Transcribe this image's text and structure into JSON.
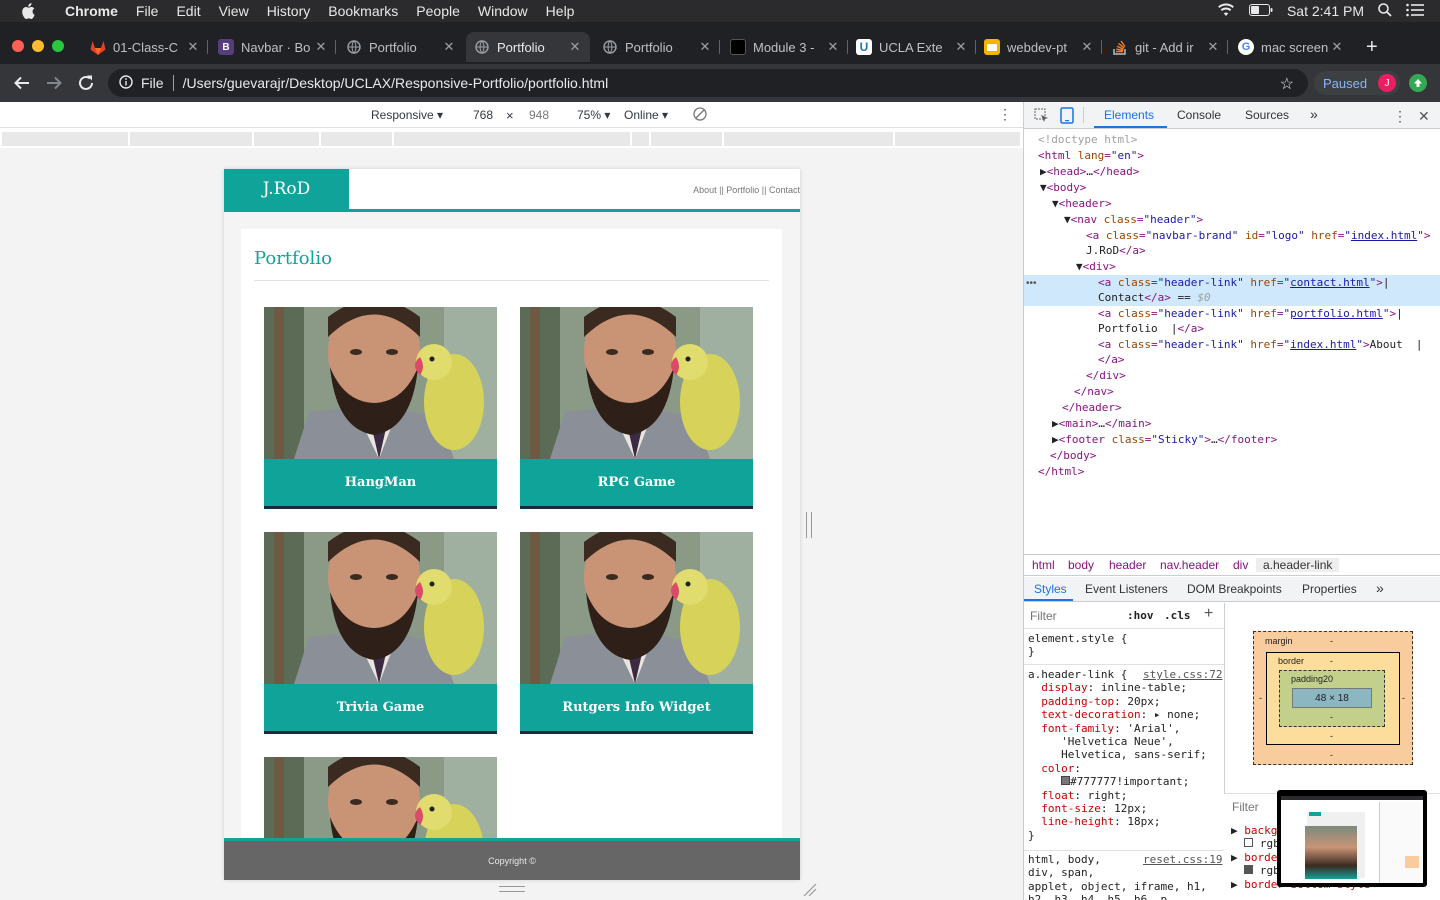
{
  "menubar": {
    "app": "Chrome",
    "items": [
      "File",
      "Edit",
      "View",
      "History",
      "Bookmarks",
      "People",
      "Window",
      "Help"
    ],
    "clock": "Sat 2:41 PM"
  },
  "tabs": [
    {
      "title": "01-Class-C",
      "icon": "gitlab-icon",
      "color": "#e24329"
    },
    {
      "title": "Navbar · Bo",
      "icon": "bootstrap-icon",
      "color": "#563d7c"
    },
    {
      "title": "Portfolio",
      "icon": "globe-icon",
      "color": "#5f6368"
    },
    {
      "title": "Portfolio",
      "icon": "globe-icon",
      "color": "#5f6368",
      "active": true
    },
    {
      "title": "Portfolio",
      "icon": "globe-icon",
      "color": "#5f6368"
    },
    {
      "title": "Module 3 -",
      "icon": "book-icon",
      "color": "#202124"
    },
    {
      "title": "UCLA Exte",
      "icon": "ucla-icon",
      "color": "#2774ae"
    },
    {
      "title": "webdev-pt",
      "icon": "slides-icon",
      "color": "#f4b400"
    },
    {
      "title": "git - Add ir",
      "icon": "stackoverflow-icon",
      "color": "#f48024"
    },
    {
      "title": "mac screen",
      "icon": "google-icon",
      "color": "#ffffff"
    }
  ],
  "omnibox": {
    "scheme_label": "File",
    "url": "/Users/guevarajr/Desktop/UCLAX/Responsive-Portfolio/portfolio.html"
  },
  "profile": {
    "status": "Paused",
    "initial": "J"
  },
  "device_toolbar": {
    "mode": "Responsive ▾",
    "width": "768",
    "times": "×",
    "height": "948",
    "zoom": "75% ▾",
    "network": "Online ▾"
  },
  "site": {
    "brand": "J.RoD",
    "nav_links": "About || Portfolio || Contact",
    "page_title": "Portfolio",
    "projects": [
      "HangMan",
      "RPG Game",
      "Trivia Game",
      "Rutgers Info Widget"
    ],
    "footer": "Copyright ©"
  },
  "devtools": {
    "tabs": [
      "Elements",
      "Console",
      "Sources",
      "»"
    ],
    "breadcrumbs": [
      "html",
      "body",
      "header",
      "nav.header",
      "div",
      "a.header-link"
    ],
    "style_tabs": [
      "Styles",
      "Event Listeners",
      "DOM Breakpoints",
      "Properties",
      "»"
    ],
    "filter_placeholder": "Filter",
    "hov": ":hov",
    "cls": ".cls",
    "box": {
      "margin": "margin",
      "border": "border",
      "padding": "padding20",
      "content": "48 × 18",
      "dash": "-"
    }
  }
}
